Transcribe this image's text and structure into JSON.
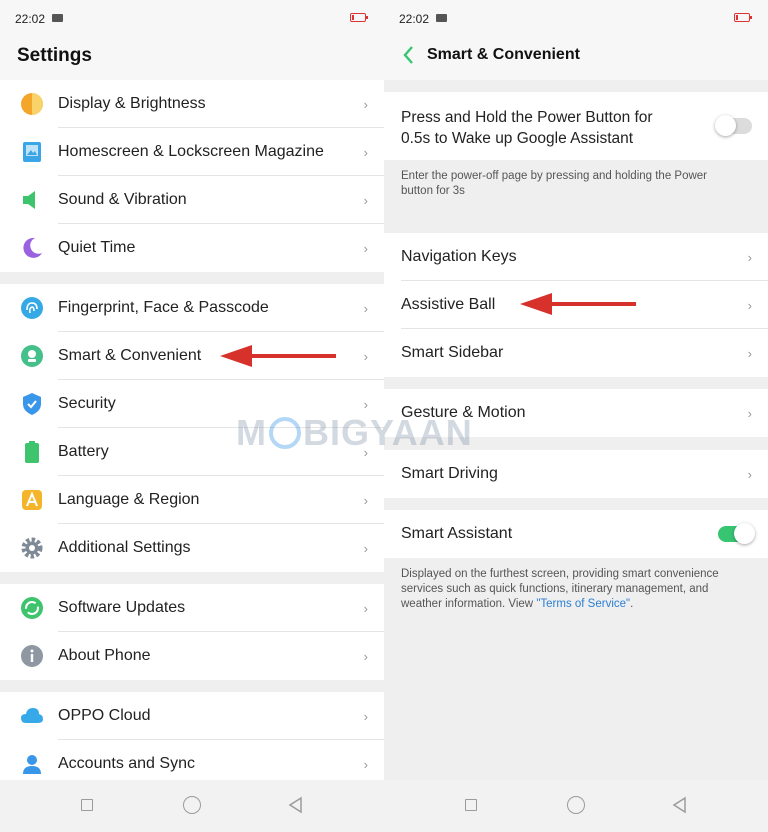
{
  "status": {
    "time": "22:02"
  },
  "left": {
    "title": "Settings",
    "groups": [
      [
        "Display & Brightness",
        "Homescreen & Lockscreen Magazine",
        "Sound & Vibration",
        "Quiet Time"
      ],
      [
        "Fingerprint, Face & Passcode",
        "Smart & Convenient",
        "Security",
        "Battery",
        "Language & Region",
        "Additional Settings"
      ],
      [
        "Software Updates",
        "About Phone"
      ],
      [
        "OPPO Cloud",
        "Accounts and Sync"
      ]
    ],
    "icons": [
      "display-icon",
      "magazine-icon",
      "sound-icon",
      "moon-icon",
      "fingerprint-icon",
      "smart-icon",
      "shield-icon",
      "battery-icon",
      "language-icon",
      "gear-icon",
      "update-icon",
      "info-icon",
      "cloud-icon",
      "account-icon"
    ]
  },
  "right": {
    "title": "Smart & Convenient",
    "power_button": {
      "label_line1": "Press and Hold the Power Button for",
      "label_line2": "0.5s to Wake up Google Assistant",
      "enabled": false,
      "note": "Enter the power-off page by pressing and holding the Power button for 3s"
    },
    "items_group1": [
      "Navigation Keys",
      "Assistive Ball",
      "Smart Sidebar"
    ],
    "items_group2": [
      "Gesture & Motion"
    ],
    "items_group3": [
      "Smart Driving"
    ],
    "smart_assistant": {
      "label": "Smart Assistant",
      "enabled": true,
      "note": "Displayed on the furthest screen, providing smart convenience services such as quick functions, itinerary management, and weather information. View ",
      "link": "\"Terms of Service\"",
      "note_end": "."
    }
  },
  "watermark": {
    "prefix": "M",
    "suffix": "BIGYAAN"
  },
  "colors": {
    "accent": "#37c572",
    "arrow": "#d7312b",
    "link": "#2a7fd4",
    "battery": "#dd3333"
  }
}
